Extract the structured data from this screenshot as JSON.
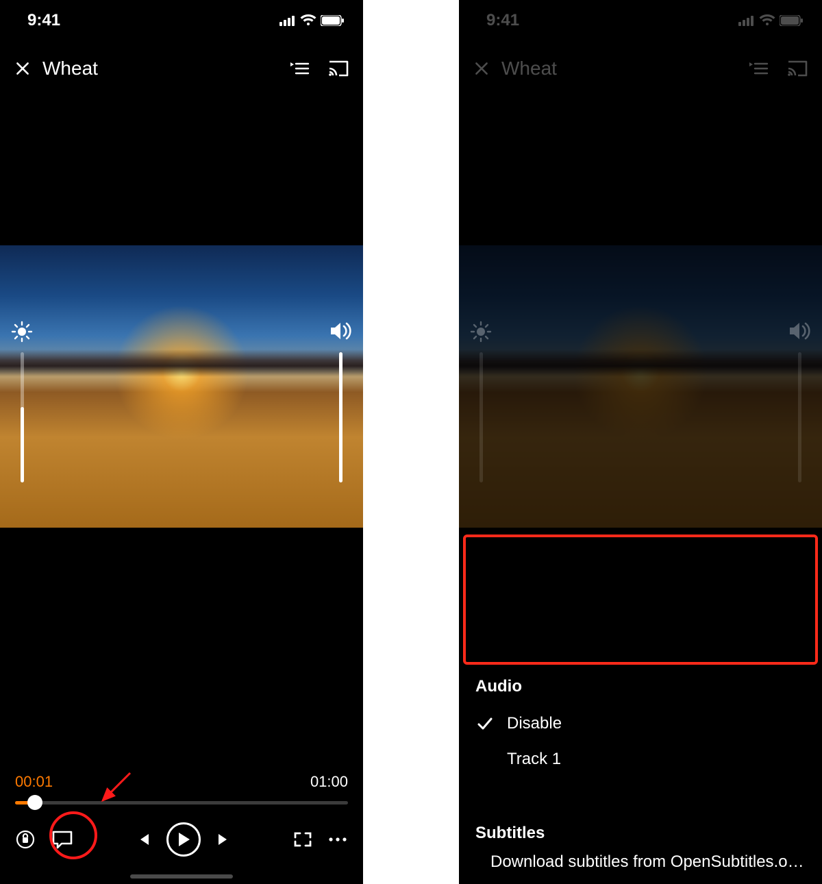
{
  "status": {
    "time": "9:41"
  },
  "header": {
    "title": "Wheat"
  },
  "player": {
    "current_time": "00:01",
    "duration": "01:00",
    "progress_percent": 2
  },
  "panel": {
    "audio": {
      "title": "Audio",
      "options": [
        "Disable",
        "Track 1"
      ],
      "selected": "Disable"
    },
    "subtitles": {
      "title": "Subtitles",
      "download_label": "Download subtitles from OpenSubtitles.org..."
    }
  },
  "icons": {
    "close": "close-icon",
    "queue": "playlist-icon",
    "cast": "cast-icon",
    "brightness": "brightness-icon",
    "volume": "volume-icon",
    "lock": "rotation-lock-icon",
    "subtitle": "subtitle-icon",
    "prev": "previous-track-icon",
    "play": "play-icon",
    "next": "next-track-icon",
    "fullscreen": "fullscreen-icon",
    "more": "more-icon",
    "check": "checkmark-icon"
  }
}
